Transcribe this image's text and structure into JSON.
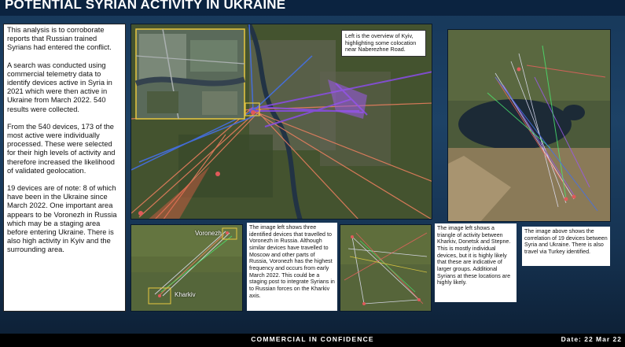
{
  "header": {
    "title": "POTENTIAL SYRIAN ACTIVITY IN UKRAINE"
  },
  "analysis": {
    "paragraphs": [
      "This analysis is to corroborate reports that Russian trained Syrians had entered the conflict.",
      "A search was conducted using commercial telemetry data to identify devices active in Syria in 2021 which were then active in Ukraine from March 2022. 540 results were collected.",
      "From the 540 devices, 173 of the most active were individually processed. These were selected for their high levels of activity and therefore increased the likelihood of validated geolocation.",
      "19 devices are of note: 8 of which have been in the Ukraine since March 2022. One important area appears to be Voronezh in Russia which may be a staging area before entering Ukraine. There is also high activity in Kyiv and the surrounding area."
    ]
  },
  "maps": {
    "main_note": "Left is the overview of Kyiv, highlighting some colocation near Naberezhne Road.",
    "russia_labels": {
      "voronezh": "Voronezh",
      "kharkiv": "Kharkiv"
    }
  },
  "captions": {
    "russia": "The image left shows three identified devices that travelled to Voronezh in Russia. Although similar devices have travelled to Moscow and other parts of Russia, Voronezh has the highest frequency and occurs from early March 2022. This could be a staging post to integrate Syrians in to Russian forces on the Kharkiv axis.",
    "triangle": "The image left shows a triangle of activity between Kharkiv, Donetsk and Stepne. This is mostly individual devices, but it is highly likely that these are indicative of larger groups. Additional Syrians at these locations are highly likely.",
    "region": "The image above shows the correlation of 19 devices between Syria and Ukraine. There is also travel via Turkey identified."
  },
  "footer": {
    "classification": "COMMERCIAL IN CONFIDENCE",
    "date": "Date: 22 Mar 22"
  }
}
